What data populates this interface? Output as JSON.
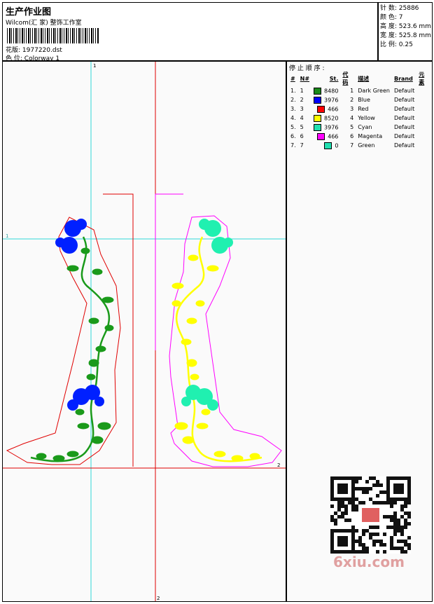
{
  "header": {
    "title": "生产作业图",
    "company": "Wilcom(汇 家) 整饰工作室",
    "design_label": "花版:",
    "design_value": "1977220.dst",
    "colorway_label": "色 位:",
    "colorway_value": "Colorway 1"
  },
  "stats": [
    {
      "label": "针 数:",
      "value": "25886"
    },
    {
      "label": "颜 色:",
      "value": "7"
    },
    {
      "label": "高 度:",
      "value": "523.6 mm"
    },
    {
      "label": "宽 度:",
      "value": "525.8 mm"
    },
    {
      "label": "比 例:",
      "value": "0.25"
    }
  ],
  "panel": {
    "title": "停 止 顺 序 :",
    "columns": [
      "#",
      "N#",
      "St.",
      "代码",
      "描述",
      "Brand",
      "元素"
    ],
    "rows": [
      {
        "idx": "1.",
        "n": "1",
        "color": "#1a8a1a",
        "st": "8480",
        "code": "1",
        "desc": "Dark Green",
        "brand": "Default"
      },
      {
        "idx": "2.",
        "n": "2",
        "color": "#0000ff",
        "st": "3976",
        "code": "2",
        "desc": "Blue",
        "brand": "Default"
      },
      {
        "idx": "3.",
        "n": "3",
        "color": "#ff0000",
        "st": "466",
        "code": "3",
        "desc": "Red",
        "brand": "Default"
      },
      {
        "idx": "4.",
        "n": "4",
        "color": "#ffff00",
        "st": "8520",
        "code": "4",
        "desc": "Yellow",
        "brand": "Default"
      },
      {
        "idx": "5.",
        "n": "5",
        "color": "#20e0b0",
        "st": "3976",
        "code": "5",
        "desc": "Cyan",
        "brand": "Default"
      },
      {
        "idx": "6.",
        "n": "6",
        "color": "#ff00ff",
        "st": "466",
        "code": "6",
        "desc": "Magenta",
        "brand": "Default"
      },
      {
        "idx": "7.",
        "n": "7",
        "color": "#20e0b0",
        "st": "0",
        "code": "7",
        "desc": "Green",
        "brand": "Default"
      }
    ]
  },
  "canvas": {
    "guide_labels": [
      "1",
      "1",
      "2",
      "2"
    ]
  },
  "watermark": "6xiu.com",
  "colors": {
    "guide_cyan": "#30d8d8",
    "guide_red": "#e00000",
    "outline_red": "#e00000",
    "outline_magenta": "#ff00ff",
    "vine_green": "#1a9a1a",
    "vine_yellow": "#ffff00",
    "flower_blue": "#0020ff",
    "flower_cyan": "#20f0b0"
  }
}
